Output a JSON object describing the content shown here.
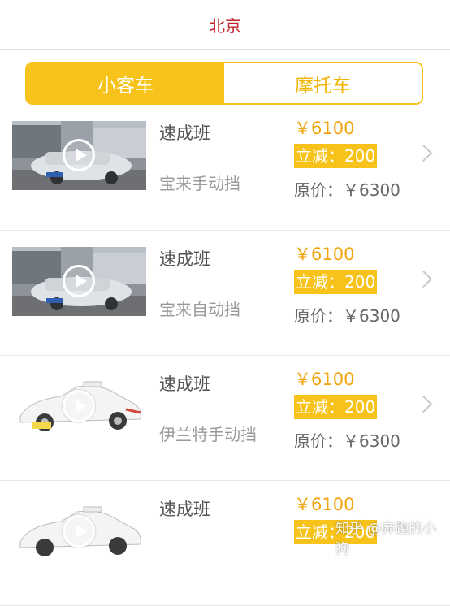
{
  "header": {
    "title": "北京"
  },
  "tabs": [
    {
      "label": "小客车",
      "active": true
    },
    {
      "label": "摩托车",
      "active": false
    }
  ],
  "items": [
    {
      "title": "速成班",
      "model": "宝来手动挡",
      "price": "￥6100",
      "discount": "立减：200",
      "original": "原价：￥6300",
      "image": "silver-sedan-street"
    },
    {
      "title": "速成班",
      "model": "宝来自动挡",
      "price": "￥6100",
      "discount": "立减：200",
      "original": "原价：￥6300",
      "image": "silver-sedan-street"
    },
    {
      "title": "速成班",
      "model": "伊兰特手动挡",
      "price": "￥6100",
      "discount": "立减：200",
      "original": "原价：￥6300",
      "image": "white-taxi"
    },
    {
      "title": "速成班",
      "model": "",
      "price": "￥6100",
      "discount": "立减：200",
      "original": "",
      "image": "white-taxi"
    }
  ],
  "watermark": "知乎 @奔跑的小狗",
  "colors": {
    "accent": "#f7c31a",
    "price": "#f2a40c",
    "header": "#c0262b"
  }
}
